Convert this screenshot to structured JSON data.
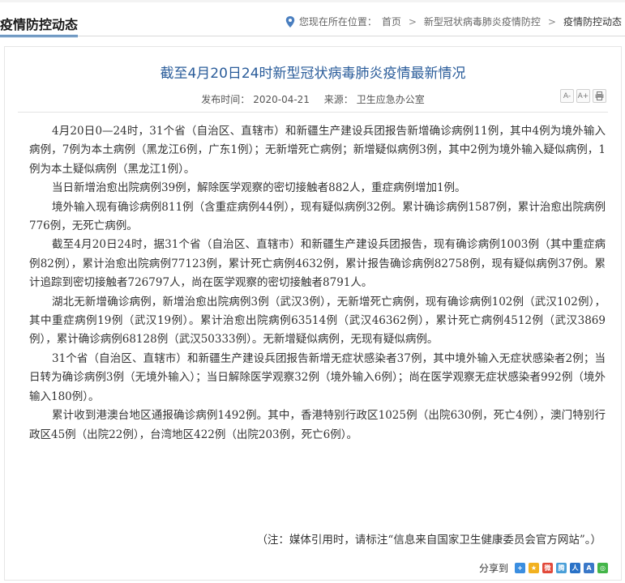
{
  "header": {
    "section_title": "疫情防控动态",
    "location_label": "您现在所在位置：",
    "breadcrumb": [
      "首页",
      "新型冠状病毒肺炎疫情防控",
      "疫情防控动态"
    ],
    "separator": ">"
  },
  "article": {
    "title": "截至4月20日24时新型冠状病毒肺炎疫情最新情况",
    "date_label": "发布时间：",
    "date": "2020-04-21",
    "source_label": "来源：",
    "source": "卫生应急办公室",
    "tools": {
      "font_smaller": "A-",
      "font_larger": "A+",
      "print": "print"
    },
    "paragraphs": [
      "4月20日0—24时，31个省（自治区、直辖市）和新疆生产建设兵团报告新增确诊病例11例，其中4例为境外输入病例，7例为本土病例（黑龙江6例，广东1例）；无新增死亡病例；新增疑似病例3例，其中2例为境外输入疑似病例，1例为本土疑似病例（黑龙江1例）。",
      "当日新增治愈出院病例39例，解除医学观察的密切接触者882人，重症病例增加1例。",
      "境外输入现有确诊病例811例（含重症病例44例），现有疑似病例32例。累计确诊病例1587例，累计治愈出院病例776例，无死亡病例。",
      "截至4月20日24时，据31个省（自治区、直辖市）和新疆生产建设兵团报告，现有确诊病例1003例（其中重症病例82例），累计治愈出院病例77123例，累计死亡病例4632例，累计报告确诊病例82758例，现有疑似病例37例。累计追踪到密切接触者726797人，尚在医学观察的密切接触者8791人。",
      "湖北无新增确诊病例，新增治愈出院病例3例（武汉3例），无新增死亡病例，现有确诊病例102例（武汉102例），其中重症病例19例（武汉19例）。累计治愈出院病例63514例（武汉46362例），累计死亡病例4512例（武汉3869例），累计确诊病例68128例（武汉50333例）。无新增疑似病例，无现有疑似病例。",
      "31个省（自治区、直辖市）和新疆生产建设兵团报告新增无症状感染者37例，其中境外输入无症状感染者2例；当日转为确诊病例3例（无境外输入）；当日解除医学观察32例（境外输入6例）；尚在医学观察无症状感染者992例（境外输入180例）。",
      "累计收到港澳台地区通报确诊病例1492例。其中，香港特别行政区1025例（出院630例，死亡4例），澳门特别行政区45例（出院22例），台湾地区422例（出院203例，死亡6例）。"
    ],
    "note": "（注：媒体引用时，请标注“信息来自国家卫生健康委员会官方网站”。）"
  },
  "share": {
    "label": "分享到",
    "icons": [
      {
        "name": "share-plus-icon",
        "glyph": "+",
        "color": "#3b8ee0"
      },
      {
        "name": "share-qzone-icon",
        "glyph": "★",
        "color": "#f2b120"
      },
      {
        "name": "share-weibo-icon",
        "glyph": "微",
        "color": "#e2493a"
      },
      {
        "name": "share-tencent-icon",
        "glyph": "腾",
        "color": "#4a9fd8"
      },
      {
        "name": "share-renren-icon",
        "glyph": "人",
        "color": "#2a72c7"
      },
      {
        "name": "share-baidu-icon",
        "glyph": "A",
        "color": "#3a78c8"
      },
      {
        "name": "share-wechat-icon",
        "glyph": "◎",
        "color": "#44b549"
      }
    ]
  }
}
